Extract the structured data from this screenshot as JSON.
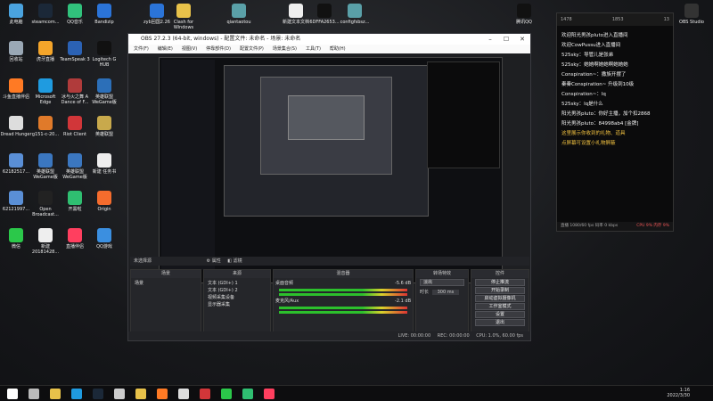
{
  "desktop_icons_left": [
    {
      "label": "此电脑",
      "color": "#4aa3df"
    },
    {
      "label": "steamcom...",
      "color": "#1b2838"
    },
    {
      "label": "QQ音乐",
      "color": "#31c27c"
    },
    {
      "label": "Bandizip",
      "color": "#2b74d8"
    },
    {
      "label": "回收站",
      "color": "#9aa8b5"
    },
    {
      "label": "虎牙直播",
      "color": "#f4a52a"
    },
    {
      "label": "TeamSpeak 3",
      "color": "#2b62b5"
    },
    {
      "label": "Logitech G HUB",
      "color": "#111111"
    },
    {
      "label": "斗鱼直播伴侣",
      "color": "#ff7a24"
    },
    {
      "label": "Microsoft Edge",
      "color": "#1f9be0"
    },
    {
      "label": "冰与火之舞 A Dance of F...",
      "color": "#b03b3b"
    },
    {
      "label": "英雄联盟 WeGame版",
      "color": "#2c6fb8"
    },
    {
      "label": "Dread Hunger",
      "color": "#dddddd"
    },
    {
      "label": "g151-c-20...",
      "color": "#e07a2a"
    },
    {
      "label": "Riot Client",
      "color": "#d13639"
    },
    {
      "label": "英雄联盟",
      "color": "#c8a94c"
    },
    {
      "label": "62182517...",
      "color": "#5a8fd6"
    },
    {
      "label": "英雄联盟 WeGame版",
      "color": "#3b77c0"
    },
    {
      "label": "英雄联盟 WeGame版",
      "color": "#3b77c0"
    },
    {
      "label": "新建 任务书",
      "color": "#eeeeee"
    },
    {
      "label": "62121997...",
      "color": "#5a8fd6"
    },
    {
      "label": "Open Broadcast...",
      "color": "#222222"
    },
    {
      "label": "开黑啦",
      "color": "#2fbf71"
    },
    {
      "label": "Origin",
      "color": "#f56c2d"
    },
    {
      "label": "微信",
      "color": "#2bc84a"
    },
    {
      "label": "新建 20181428...",
      "color": "#eeeeee"
    },
    {
      "label": "直播伴侣",
      "color": "#ff3f5f"
    },
    {
      "label": "QQ游戏",
      "color": "#3b8fe0"
    }
  ],
  "desktop_icons_top": [
    {
      "label": "zyb回国2.26",
      "color": "#2b74d8"
    },
    {
      "label": "Clash for Windows",
      "color": "#e8c24a"
    },
    {
      "label": "qiantaotou",
      "color": "#5aa0a8"
    },
    {
      "label": "新建文本文档",
      "color": "#eeeeee"
    },
    {
      "label": "6DFFA2653...",
      "color": "#111111"
    },
    {
      "label": "configfsbsz...",
      "color": "#5aa0a8"
    }
  ],
  "desktop_icons_right": [
    {
      "label": "腾讯QQ",
      "color": "#111111"
    },
    {
      "label": "OBS Studio",
      "color": "#333333"
    }
  ],
  "obs": {
    "title": "OBS 27.2.3 (64-bit, windows) - 配置文件: 未命名 - 场景: 未命名",
    "menu": [
      "文件(F)",
      "编辑(E)",
      "视图(V)",
      "停靠部件(D)",
      "配置文件(P)",
      "场景集合(S)",
      "工具(T)",
      "帮助(H)"
    ],
    "preview_bar": {
      "unselected": "未选择源",
      "properties": "属性",
      "filters": "滤镜"
    },
    "docks": {
      "scenes": {
        "title": "场景",
        "items": [
          "场景"
        ]
      },
      "sources": {
        "title": "来源",
        "items": [
          "文本 (GDI+) 1",
          "文本 (GDI+) 2",
          "视频采集设备",
          "显示器采集"
        ]
      },
      "mixer": {
        "title": "混音器",
        "tracks": [
          {
            "name": "桌面音频",
            "db": "-5.6 dB"
          },
          {
            "name": "麦克风/Aux",
            "db": "-2.1 dB"
          }
        ]
      },
      "transitions": {
        "title": "转场特效",
        "type": "淡出",
        "duration_label": "时长",
        "duration": "300 ms"
      },
      "controls": {
        "title": "控件",
        "buttons": [
          "停止推流",
          "开始录制",
          "启动虚拟摄像机",
          "工作室模式",
          "设置",
          "退出"
        ]
      }
    },
    "status": {
      "live_label": "LIVE:",
      "live_time": "00:00:00",
      "rec_label": "REC:",
      "rec_time": "00:00:00",
      "cpu": "CPU: 1.0%, 60.00 fps"
    }
  },
  "chat": {
    "header": {
      "left": "1478",
      "mid": "1853",
      "right": "13"
    },
    "messages": [
      "欢迎阳光男孩pluto进入直播间",
      "欢迎CowPussu进入直播间",
      "525sky：导管儿是张弟",
      "525sky：她她啊她她啊她她她",
      "Conspiration~：撒族开摆了",
      "秦秦Conspiration~ 升级到10级",
      "Conspiration~：lq",
      "525sky：lq是什么",
      "阳光男孩pluto：你好主播，加个扣2868",
      "阳光男孩pluto：84998ab4 [金牌]",
      "这里展示你收到的礼物、道具",
      "点屏幕可设置小礼物屏蔽"
    ],
    "footer": {
      "left": "直播 1080/60 fps 码率 0 kbps",
      "right": "CPU 9% 内存 9%"
    }
  },
  "taskbar": {
    "icons": [
      {
        "name": "start",
        "color": "#ffffff"
      },
      {
        "name": "search",
        "color": "#bbbbbb"
      },
      {
        "name": "file-explorer",
        "color": "#e8c24a"
      },
      {
        "name": "edge",
        "color": "#1f9be0"
      },
      {
        "name": "steam",
        "color": "#1b2838"
      },
      {
        "name": "qq",
        "color": "#cccccc"
      },
      {
        "name": "clash",
        "color": "#e8c24a"
      },
      {
        "name": "douyu",
        "color": "#ff7a24"
      },
      {
        "name": "obs",
        "color": "#dddddd"
      },
      {
        "name": "chat-app",
        "color": "#d13639"
      },
      {
        "name": "wechat",
        "color": "#2bc84a"
      },
      {
        "name": "kaiheila",
        "color": "#2fbf71"
      },
      {
        "name": "live-companion",
        "color": "#ff3f5f"
      }
    ],
    "time": "1:16",
    "date": "2022/3/30"
  }
}
